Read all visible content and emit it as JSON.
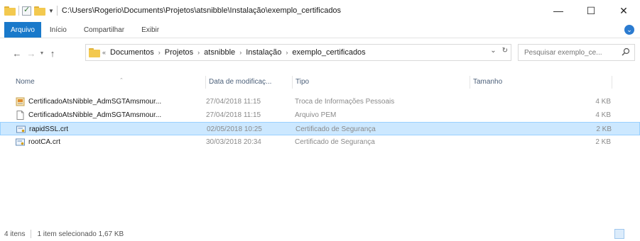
{
  "titlebar": {
    "path": "C:\\Users\\Rogerio\\Documents\\Projetos\\atsnibble\\Instalação\\exemplo_certificados",
    "minimize": "—",
    "maximize": "☐",
    "close": "✕"
  },
  "ribbon": {
    "tabs": [
      "Arquivo",
      "Início",
      "Compartilhar",
      "Exibir"
    ],
    "accent": "#1979ca"
  },
  "nav": {
    "back": "←",
    "forward": "→",
    "up": "↑",
    "breadcrumb_prefix": "«",
    "breadcrumbs": [
      "Documentos",
      "Projetos",
      "atsnibble",
      "Instalação",
      "exemplo_certificados"
    ],
    "refresh": "↻"
  },
  "search": {
    "placeholder": "Pesquisar exemplo_ce..."
  },
  "columns": {
    "name": "Nome",
    "date": "Data de modificaç...",
    "type": "Tipo",
    "size": "Tamanho"
  },
  "files": [
    {
      "name": "CertificadoAtsNibble_AdmSGTAmsmour...",
      "date": "27/04/2018 11:15",
      "type": "Troca de Informações Pessoais",
      "size": "4 KB",
      "icon": "pfx-certificate-icon",
      "selected": false
    },
    {
      "name": "CertificadoAtsNibble_AdmSGTAmsmour...",
      "date": "27/04/2018 11:15",
      "type": "Arquivo PEM",
      "size": "4 KB",
      "icon": "blank-file-icon",
      "selected": false
    },
    {
      "name": "rapidSSL.crt",
      "date": "02/05/2018 10:25",
      "type": "Certificado de Segurança",
      "size": "2 KB",
      "icon": "certificate-file-icon",
      "selected": true
    },
    {
      "name": "rootCA.crt",
      "date": "30/03/2018 20:34",
      "type": "Certificado de Segurança",
      "size": "2 KB",
      "icon": "certificate-file-icon",
      "selected": false
    }
  ],
  "status": {
    "count": "4 itens",
    "selection": "1 item selecionado  1,67 KB"
  },
  "colors": {
    "selection_bg": "#cce8ff",
    "selection_border": "#99d1ff",
    "folder": "#f3c94f",
    "header_text": "#4c607a"
  }
}
